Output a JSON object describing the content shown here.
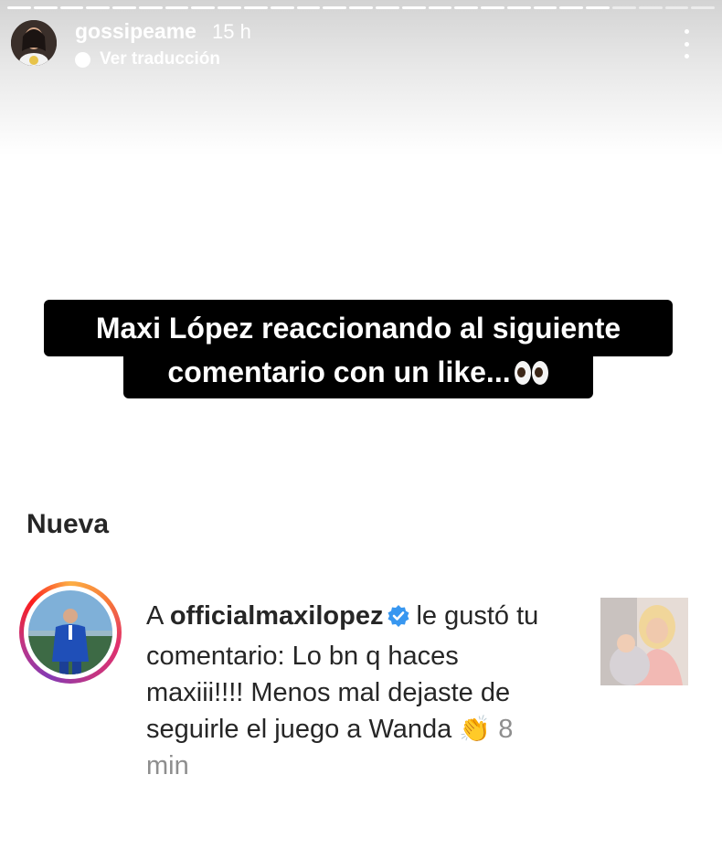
{
  "story": {
    "username": "gossipeame",
    "time_ago": "15 h",
    "translate_label": "Ver traducción",
    "more_icon": "more-vertical-icon"
  },
  "caption": {
    "line1": "Maxi López reaccionando al siguiente",
    "line2": "comentario con un like..."
  },
  "notification": {
    "section_label": "Nueva",
    "prefix": "A",
    "account": "officialmaxilopez",
    "message": "le gustó tu comentario: Lo bn q haces maxiii!!!! Menos mal dejaste de seguirle el juego a Wanda",
    "time": "8 min"
  },
  "colors": {
    "caption_bg": "#000000",
    "verified_blue": "#3897f0",
    "text": "#262626",
    "muted": "#8e8e8e"
  }
}
